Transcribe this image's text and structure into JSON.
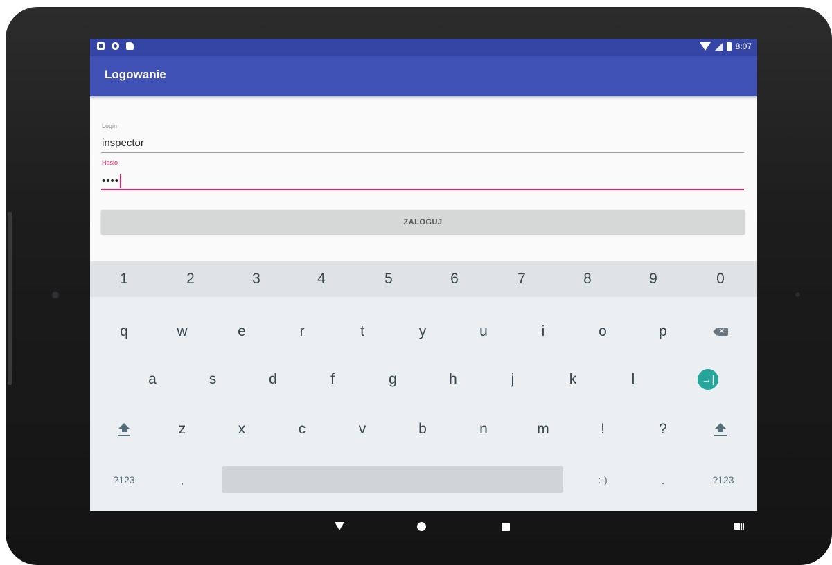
{
  "status_bar": {
    "time": "8:07",
    "left_icons": [
      "photo-icon",
      "circle-icon",
      "sd-card-icon"
    ],
    "right_icons": [
      "wifi-icon",
      "signal-icon",
      "battery-icon"
    ]
  },
  "app_bar": {
    "title": "Logowanie",
    "color": "#3f51b5"
  },
  "form": {
    "login_label": "Login",
    "login_value": "inspector",
    "password_label": "Hasło",
    "password_value": "••••",
    "accent_color": "#e91e63",
    "submit_label": "ZALOGUJ"
  },
  "keyboard": {
    "numbers": [
      "1",
      "2",
      "3",
      "4",
      "5",
      "6",
      "7",
      "8",
      "9",
      "0"
    ],
    "row1": [
      "q",
      "w",
      "e",
      "r",
      "t",
      "y",
      "u",
      "i",
      "o",
      "p"
    ],
    "row2": [
      "a",
      "s",
      "d",
      "f",
      "g",
      "h",
      "j",
      "k",
      "l"
    ],
    "row3": [
      "z",
      "x",
      "c",
      "v",
      "b",
      "n",
      "m",
      "!",
      "?"
    ],
    "row4_left": "?123",
    "row4_comma": ",",
    "row4_smiley": ":-)",
    "row4_period": ".",
    "row4_right": "?123",
    "go_icon": "→|"
  },
  "nav_bar": {
    "icons": [
      "back-icon",
      "home-icon",
      "recents-icon",
      "keyboard-icon"
    ]
  }
}
